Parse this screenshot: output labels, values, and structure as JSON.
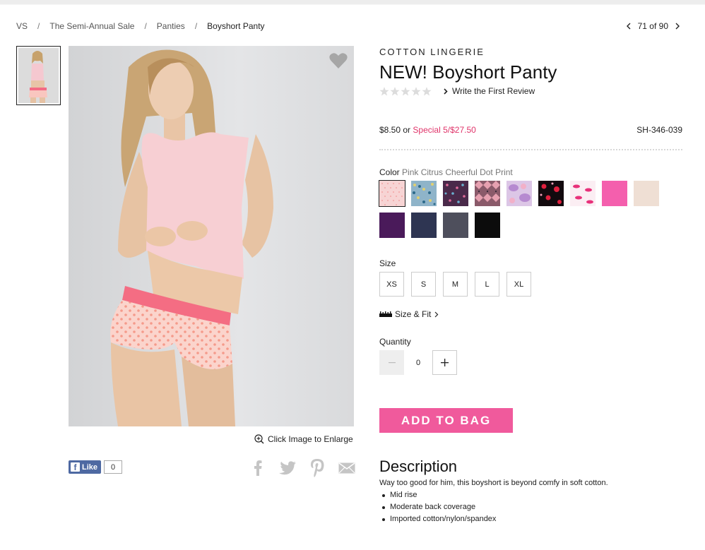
{
  "breadcrumb": {
    "items": [
      "VS",
      "The Semi-Annual Sale",
      "Panties"
    ],
    "current": "Boyshort Panty",
    "separator": "/"
  },
  "pager": {
    "label": "71 of 90"
  },
  "product": {
    "brand": "COTTON LINGERIE",
    "title": "NEW! Boyshort Panty",
    "review_link": "Write the First Review",
    "price_regular": "$8.50",
    "price_or": "or",
    "price_special": "Special 5/$27.50",
    "sku": "SH-346-039"
  },
  "image": {
    "enlarge_label": "Click Image to Enlarge"
  },
  "social": {
    "like_label": "Like",
    "like_count": "0"
  },
  "color": {
    "label": "Color",
    "selected_name": "Pink Citrus Cheerful Dot Print",
    "swatches": [
      {
        "name": "pink-citrus-dot",
        "color": "#f6d2d2"
      },
      {
        "name": "blue-print",
        "color": "#7aa6c2"
      },
      {
        "name": "purple-confetti",
        "color": "#6a3a5a"
      },
      {
        "name": "geometric-print",
        "color": "#a06a7a"
      },
      {
        "name": "lavender-floral",
        "color": "#c8a6d6"
      },
      {
        "name": "black-red-hearts",
        "color": "#1a0d12"
      },
      {
        "name": "lips-print",
        "color": "#fbeaf0"
      },
      {
        "name": "hot-pink",
        "color": "#f45fad"
      },
      {
        "name": "nude",
        "color": "#efdfd4"
      },
      {
        "name": "purple",
        "color": "#4a1a5a"
      },
      {
        "name": "navy",
        "color": "#2e3552"
      },
      {
        "name": "charcoal",
        "color": "#4e4f5c"
      },
      {
        "name": "black",
        "color": "#0c0c0c"
      }
    ]
  },
  "size": {
    "label": "Size",
    "options": [
      "XS",
      "S",
      "M",
      "L",
      "XL"
    ],
    "fit_label": "Size & Fit"
  },
  "quantity": {
    "label": "Quantity",
    "value": "0"
  },
  "cta": {
    "add_to_bag": "ADD TO BAG"
  },
  "description": {
    "title": "Description",
    "text": "Way too good for him, this boyshort is beyond comfy in soft cotton.",
    "bullets": [
      "Mid rise",
      "Moderate back coverage",
      "Imported cotton/nylon/spandex"
    ]
  },
  "colors": {
    "accent_pink": "#f05a9c",
    "special_price": "#e0346a",
    "facebook": "#4e69a2"
  }
}
